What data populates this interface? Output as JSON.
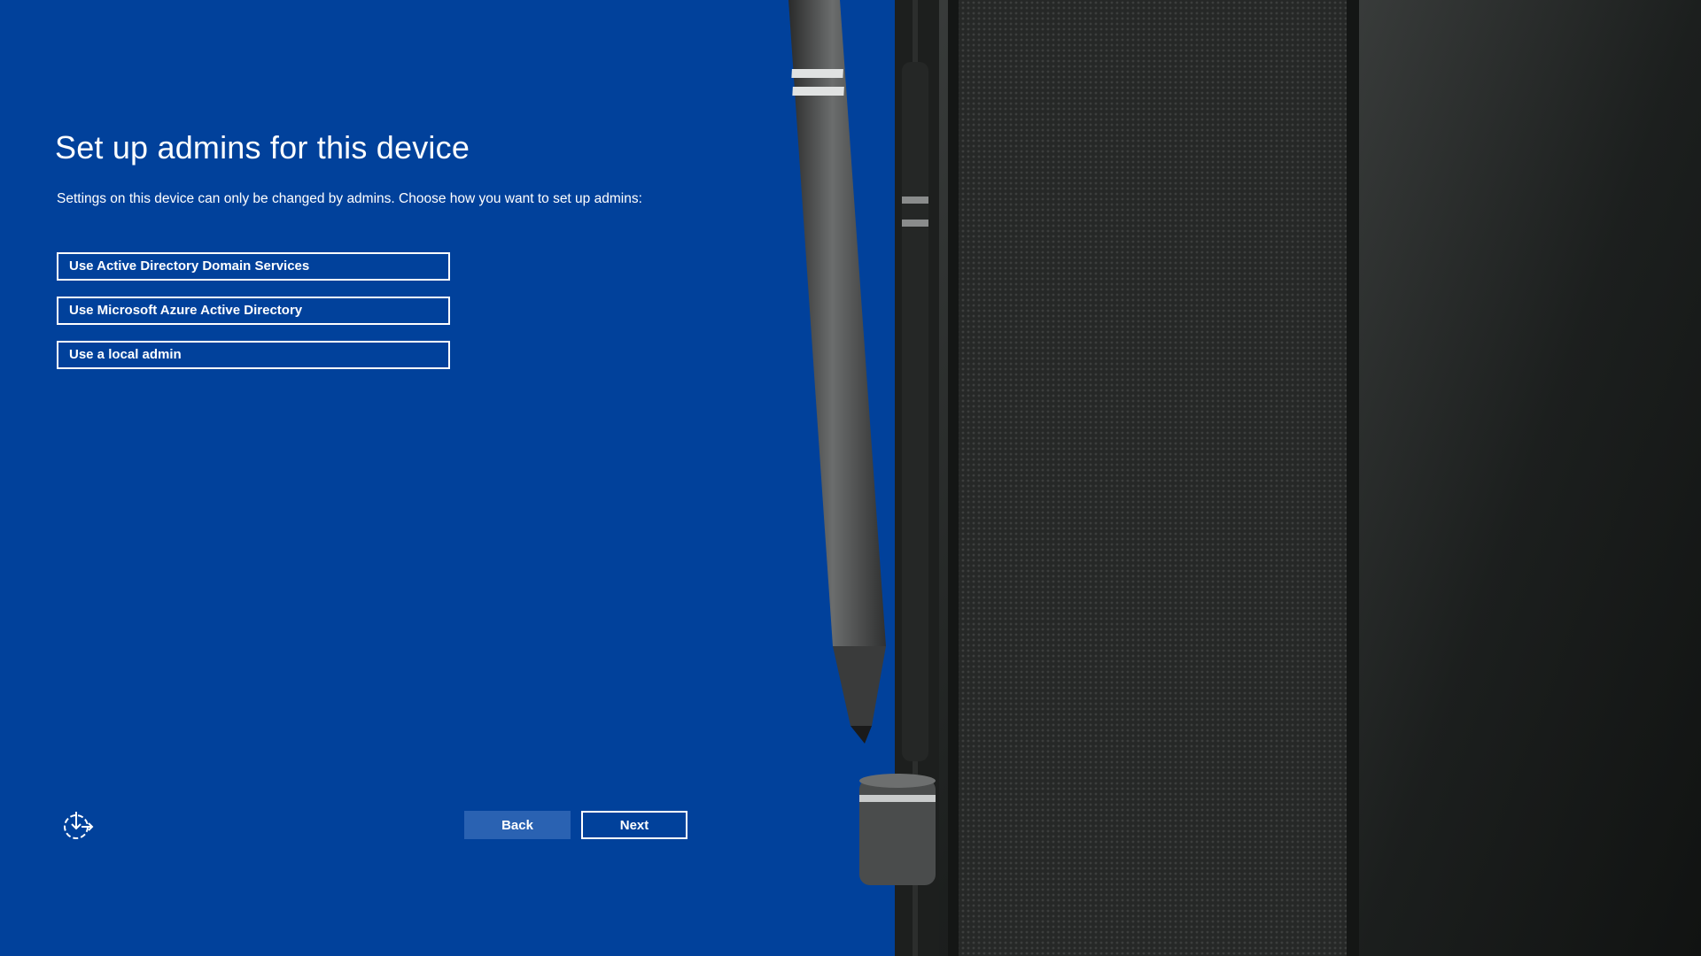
{
  "page": {
    "title": "Set up admins for this device",
    "subtitle": "Settings on this device can only be changed by admins. Choose how you want to set up admins:"
  },
  "options": [
    {
      "label": "Use Active Directory Domain Services"
    },
    {
      "label": "Use Microsoft Azure Active Directory"
    },
    {
      "label": "Use a local admin"
    }
  ],
  "footer": {
    "accessibility_icon": "ease-of-access-icon",
    "back_label": "Back",
    "next_label": "Next"
  },
  "hero": {
    "image": "device-with-pen"
  },
  "colors": {
    "background_blue": "#01419b",
    "back_button": "#2a62b2",
    "text": "#ffffff"
  }
}
